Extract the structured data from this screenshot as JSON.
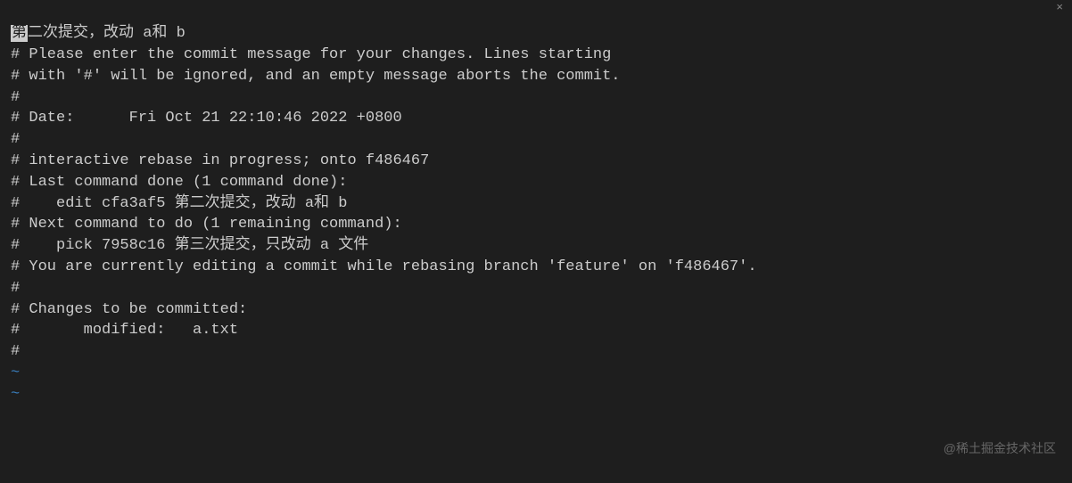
{
  "editor": {
    "cursor_char": "第",
    "commit_message_rest": "二次提交，改动 a和 b",
    "lines": [
      "",
      "# Please enter the commit message for your changes. Lines starting",
      "# with '#' will be ignored, and an empty message aborts the commit.",
      "#",
      "# Date:      Fri Oct 21 22:10:46 2022 +0800",
      "#",
      "# interactive rebase in progress; onto f486467",
      "# Last command done (1 command done):",
      "#    edit cfa3af5 第二次提交，改动 a和 b",
      "# Next command to do (1 remaining command):",
      "#    pick 7958c16 第三次提交，只改动 a 文件",
      "# You are currently editing a commit while rebasing branch 'feature' on 'f486467'.",
      "#",
      "# Changes to be committed:",
      "#       modified:   a.txt",
      "#"
    ],
    "tilde": "~"
  },
  "topbar": {
    "left": "",
    "close": "×"
  },
  "watermark": "@稀土掘金技术社区"
}
